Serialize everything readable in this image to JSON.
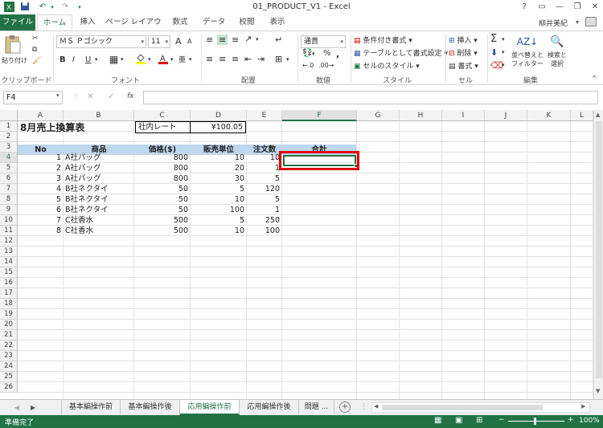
{
  "window": {
    "title": "01_PRODUCT_V1 - Excel",
    "user": "柳井美紀",
    "help": "?"
  },
  "quick_access": {
    "save_icon": "save-icon",
    "undo_icon": "undo-icon",
    "redo_icon": "redo-icon"
  },
  "tabs": [
    {
      "label": "ファイル",
      "active": false
    },
    {
      "label": "ホーム",
      "active": true
    },
    {
      "label": "挿入",
      "active": false
    },
    {
      "label": "ページ レイアウト",
      "active": false
    },
    {
      "label": "数式",
      "active": false
    },
    {
      "label": "データ",
      "active": false
    },
    {
      "label": "校閲",
      "active": false
    },
    {
      "label": "表示",
      "active": false
    }
  ],
  "ribbon": {
    "clipboard": {
      "paste": "貼り付け",
      "label": "クリップボード"
    },
    "font": {
      "name": "ＭＳ Ｐゴシック",
      "size": "11",
      "bold": "B",
      "italic": "I",
      "underline": "U",
      "grow": "A",
      "shrink": "A",
      "label": "フォント"
    },
    "alignment": {
      "label": "配置"
    },
    "number": {
      "format": "通貨",
      "percent": "%",
      "comma": ",",
      "label": "数値"
    },
    "styles": {
      "conditional": "条件付き書式",
      "table": "テーブルとして書式設定",
      "cell": "セルのスタイル",
      "label": "スタイル"
    },
    "cells": {
      "insert": "挿入",
      "delete": "削除",
      "format": "書式",
      "label": "セル"
    },
    "editing": {
      "sigma": "Σ",
      "sort": "並べ替えと",
      "sort2": "フィルター",
      "find": "検索と",
      "find2": "選択",
      "label": "編集"
    }
  },
  "formula_bar": {
    "name_box": "F4",
    "formula": "",
    "fx": "fx"
  },
  "columns": [
    "A",
    "B",
    "C",
    "D",
    "E",
    "F",
    "G",
    "H",
    "I",
    "J",
    "K",
    "L"
  ],
  "rows": [
    "1",
    "2",
    "3",
    "4",
    "5",
    "6",
    "7",
    "8",
    "9",
    "10",
    "11",
    "12",
    "13",
    "14",
    "15",
    "16",
    "17",
    "18",
    "19",
    "20",
    "21",
    "22",
    "23",
    "24",
    "25",
    "26"
  ],
  "sheet": {
    "title": "8月売上換算表",
    "rate_label": "社内レート",
    "rate_value": "¥100.05",
    "headers": {
      "no": "No",
      "product": "商品",
      "price": "価格($)",
      "unit": "販売単位",
      "qty": "注文数",
      "total": "合計"
    },
    "rows": [
      {
        "no": "1",
        "product": "A社バッグ",
        "price": "800",
        "unit": "10",
        "qty": "10"
      },
      {
        "no": "2",
        "product": "A社バッグ",
        "price": "800",
        "unit": "20",
        "qty": "1"
      },
      {
        "no": "3",
        "product": "A社バッグ",
        "price": "800",
        "unit": "30",
        "qty": "5"
      },
      {
        "no": "4",
        "product": "B社ネクタイ",
        "price": "50",
        "unit": "5",
        "qty": "120"
      },
      {
        "no": "5",
        "product": "B社ネクタイ",
        "price": "50",
        "unit": "10",
        "qty": "5"
      },
      {
        "no": "6",
        "product": "B社ネクタイ",
        "price": "50",
        "unit": "100",
        "qty": "1"
      },
      {
        "no": "7",
        "product": "C社香水",
        "price": "500",
        "unit": "5",
        "qty": "250"
      },
      {
        "no": "8",
        "product": "C社香水",
        "price": "500",
        "unit": "10",
        "qty": "100"
      }
    ]
  },
  "sheet_tabs": [
    {
      "label": "基本編操作前",
      "active": false
    },
    {
      "label": "基本編操作後",
      "active": false
    },
    {
      "label": "応用編操作前",
      "active": true
    },
    {
      "label": "応用編操作後",
      "active": false
    },
    {
      "label": "問題 ...",
      "active": false
    }
  ],
  "status": {
    "text": "準備完了",
    "zoom": "100%"
  },
  "colors": {
    "accent": "#217346",
    "header_fill": "#bdd7ee",
    "highlight": "#e00000"
  }
}
